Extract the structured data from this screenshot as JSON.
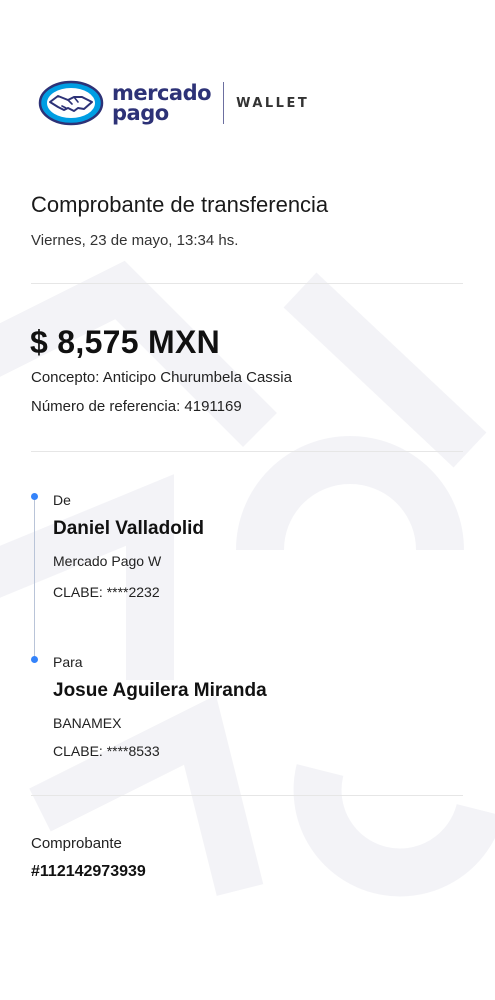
{
  "brand": {
    "logo_line1": "mercado",
    "logo_line2": "pago",
    "product": "WALLET",
    "colors": {
      "brand_blue": "#009ee3",
      "brand_navy": "#2d3277",
      "accent": "#3483fa"
    }
  },
  "receipt": {
    "title": "Comprobante de transferencia",
    "date": "Viernes, 23 de mayo, 13:34 hs.",
    "amount": "$ 8,575 MXN",
    "concept": "Concepto: Anticipo Churumbela Cassia",
    "reference": "Número de referencia: 4191169"
  },
  "from": {
    "label": "De",
    "name": "Daniel Valladolid",
    "bank": "Mercado Pago W",
    "clabe": "CLABE: ****2232"
  },
  "to": {
    "label": "Para",
    "name": "Josue Aguilera Miranda",
    "bank": "BANAMEX",
    "clabe": "CLABE: ****8533"
  },
  "voucher": {
    "label": "Comprobante",
    "number": "#112142973939"
  },
  "icons": [
    "mercado-pago-handshake-icon",
    "timeline-dot-icon"
  ]
}
